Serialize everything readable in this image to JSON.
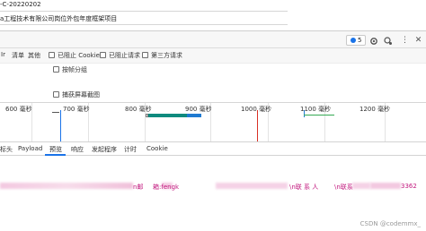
{
  "page": {
    "line1": "-C-20220202",
    "line2": "a工程技术有限公司岗位外包年度框架项目"
  },
  "devtools_topbar": {
    "issues_count": "5",
    "icons": [
      "settings-icon",
      "more-icon",
      "close-icon"
    ]
  },
  "filters": {
    "items": [
      "Ir",
      "清单",
      "其他"
    ],
    "checkbox_blocked_cookies": "已阻止 Cookie",
    "checkbox_blocked_requests": "已阻止请求",
    "checkbox_third_party": "第三方请求",
    "checkbox_group_by_frame": "按帧分组",
    "checkbox_capture_screenshots": "捕获屏幕截图"
  },
  "overview": {
    "ticks": [
      {
        "value": "600",
        "unit": "毫秒"
      },
      {
        "value": "700",
        "unit": "毫秒"
      },
      {
        "value": "800",
        "unit": "毫秒"
      },
      {
        "value": "900",
        "unit": "毫秒"
      },
      {
        "value": "1000",
        "unit": "毫秒"
      },
      {
        "value": "1100",
        "unit": "毫秒"
      },
      {
        "value": "1200",
        "unit": "毫秒"
      }
    ],
    "colors": {
      "waiting": "#0f8a7e",
      "receive": "#1f7ad1",
      "marker_red": "#d93025",
      "marker_blue": "#1a73e8",
      "green_bar": "#33a852"
    }
  },
  "tabs": [
    "标头",
    "Payload",
    "预览",
    "响应",
    "发起程序",
    "计时",
    "Cookie"
  ],
  "active_tab": "预览",
  "preview": {
    "segments": [
      "n邮",
      "箱:fengk",
      "\\n联 系 人",
      "\\n联系",
      "3362"
    ]
  },
  "watermark": "CSDN @codemmx_"
}
